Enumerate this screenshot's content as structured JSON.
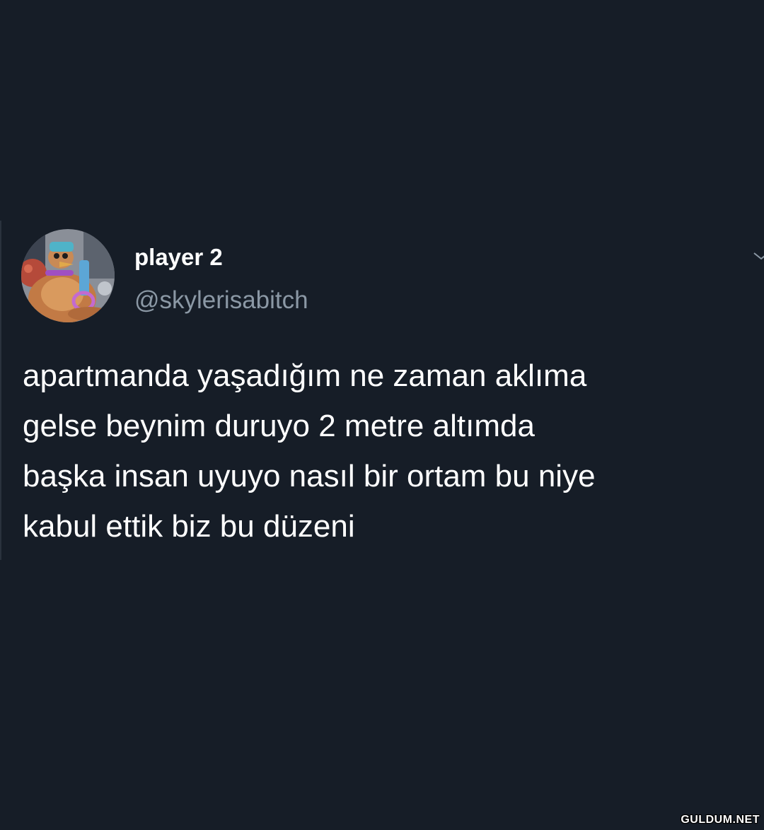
{
  "tweet": {
    "author": {
      "display_name": "player 2",
      "handle": "@skylerisabitch",
      "avatar_icon": "avatar-cartoon-chicken-icon"
    },
    "menu_icon": "chevron-down-icon",
    "text_lines": [
      "apartmanda yaşadığım ne zaman aklıma",
      "gelse beynim duruyo 2 metre altımda",
      "başka insan uyuyo nasıl bir ortam bu niye",
      "kabul ettik biz bu düzeni"
    ]
  },
  "watermark": "GULDUM.NET",
  "colors": {
    "background": "#161d27",
    "primary_text": "#ffffff",
    "secondary_text": "#8b98a5"
  }
}
